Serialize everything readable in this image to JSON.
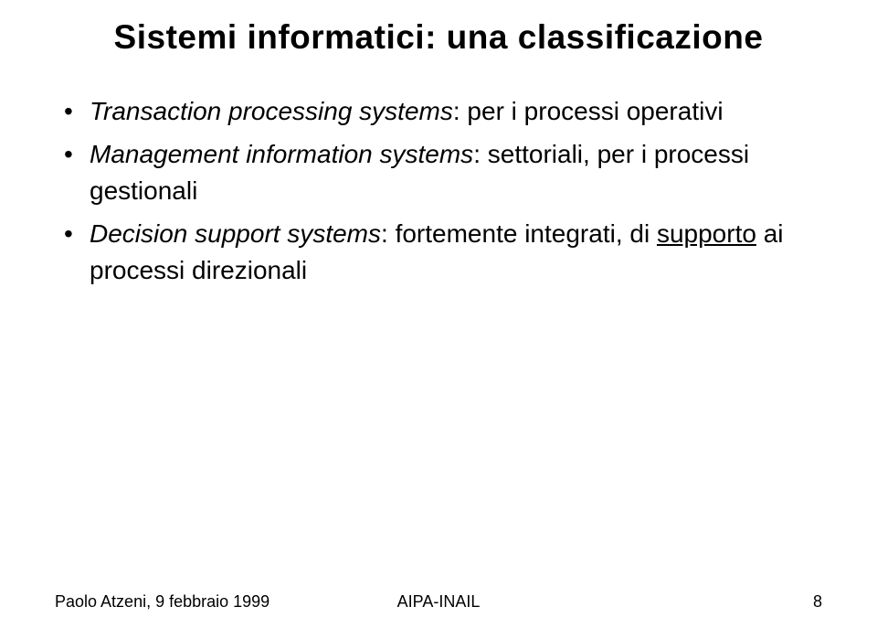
{
  "title": "Sistemi informatici: una classificazione",
  "bullets": [
    {
      "term": "Transaction processing systems",
      "sep": ": ",
      "desc_pre": "per i processi operativi",
      "underline": "",
      "desc_post": ""
    },
    {
      "term": "Management information systems",
      "sep": ": ",
      "desc_pre": "settoriali, per i processi gestionali",
      "underline": "",
      "desc_post": ""
    },
    {
      "term": "Decision support systems",
      "sep": ": ",
      "desc_pre": "fortemente integrati, di ",
      "underline": "supporto",
      "desc_post": " ai processi direzionali"
    }
  ],
  "footer": {
    "left": "Paolo Atzeni, 9 febbraio 1999",
    "center": "AIPA-INAIL",
    "right": "8"
  }
}
